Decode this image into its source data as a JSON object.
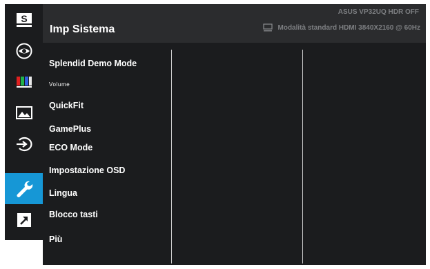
{
  "header": {
    "title": "Imp Sistema",
    "model_line": "ASUS  VP32UQ  HDR OFF",
    "status_line": "Modalità standard HDMI 3840X2160 @ 60Hz",
    "status_icon": "monitor-icon"
  },
  "rail": {
    "active_index": 5,
    "active_color": "#1697d6",
    "items": [
      {
        "icon": "splendid-s-icon",
        "glyph": "S"
      },
      {
        "icon": "eye-care-icon"
      },
      {
        "icon": "color-bars-icon"
      },
      {
        "icon": "image-icon"
      },
      {
        "icon": "input-select-icon"
      },
      {
        "icon": "wrench-icon"
      },
      {
        "icon": "shortcut-arrow-icon"
      }
    ]
  },
  "menu": {
    "items": [
      {
        "label": "Splendid Demo Mode"
      },
      {
        "label": "Volume"
      },
      {
        "label": "QuickFit"
      },
      {
        "label": "GamePlus"
      },
      {
        "label": "ECO Mode"
      },
      {
        "label": "Impostazione OSD"
      },
      {
        "label": "Lingua"
      },
      {
        "label": "Blocco tasti"
      },
      {
        "label": "Più"
      }
    ]
  }
}
